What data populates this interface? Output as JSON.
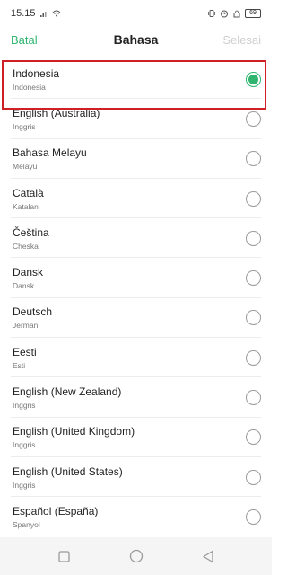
{
  "status_bar": {
    "time": "15.15",
    "battery": "69"
  },
  "header": {
    "cancel_label": "Batal",
    "title": "Bahasa",
    "done_label": "Selesai"
  },
  "languages": [
    {
      "name": "Indonesia",
      "sub": "Indonesia",
      "selected": true
    },
    {
      "name": "English (Australia)",
      "sub": "Inggris",
      "selected": false
    },
    {
      "name": "Bahasa Melayu",
      "sub": "Melayu",
      "selected": false
    },
    {
      "name": "Català",
      "sub": "Katalan",
      "selected": false
    },
    {
      "name": "Čeština",
      "sub": "Cheska",
      "selected": false
    },
    {
      "name": "Dansk",
      "sub": "Dansk",
      "selected": false
    },
    {
      "name": "Deutsch",
      "sub": "Jerman",
      "selected": false
    },
    {
      "name": "Eesti",
      "sub": "Esti",
      "selected": false
    },
    {
      "name": "English (New Zealand)",
      "sub": "Inggris",
      "selected": false
    },
    {
      "name": "English (United Kingdom)",
      "sub": "Inggris",
      "selected": false
    },
    {
      "name": "English (United States)",
      "sub": "Inggris",
      "selected": false
    },
    {
      "name": "Español (España)",
      "sub": "Spanyol",
      "selected": false
    }
  ],
  "colors": {
    "accent": "#2fb56f",
    "highlight": "#d01f26"
  },
  "icons": {
    "nav": [
      "square-recents-icon",
      "circle-home-icon",
      "triangle-back-icon"
    ]
  }
}
